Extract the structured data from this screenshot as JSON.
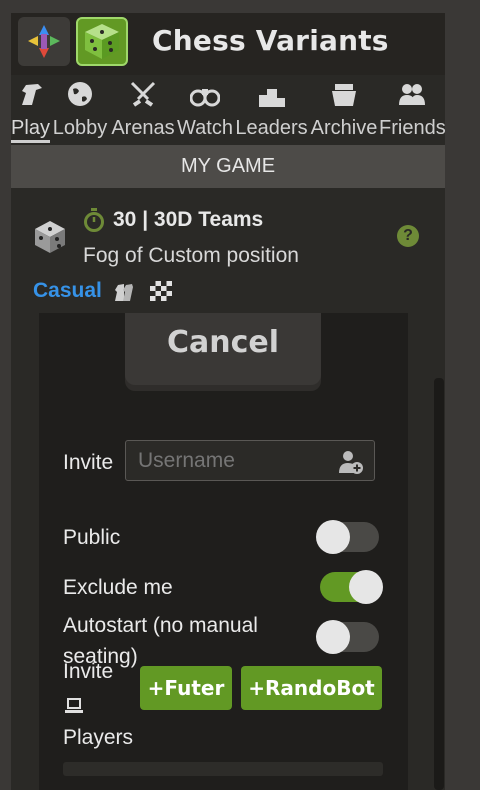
{
  "app": {
    "title": "Chess Variants"
  },
  "nav": {
    "items": [
      {
        "label": "Play",
        "icon": "knight-icon"
      },
      {
        "label": "Lobby",
        "icon": "globe-icon"
      },
      {
        "label": "Arenas",
        "icon": "crossed-swords-icon"
      },
      {
        "label": "Watch",
        "icon": "binoculars-icon"
      },
      {
        "label": "Leaders",
        "icon": "podium-icon"
      },
      {
        "label": "Archive",
        "icon": "archive-icon"
      },
      {
        "label": "Friends",
        "icon": "friends-icon"
      }
    ]
  },
  "section": {
    "title": "MY GAME"
  },
  "game": {
    "time_control": "30 | 30D Teams",
    "variant": "Fog of Custom position",
    "mode": "Casual",
    "help": "?"
  },
  "actions": {
    "cancel_label": "Cancel"
  },
  "form": {
    "invite_label": "Invite",
    "username_placeholder": "Username",
    "public_label": "Public",
    "public_on": false,
    "exclude_label": "Exclude me",
    "exclude_on": true,
    "autostart_label": "Autostart (no manual seating)",
    "autostart_on": false,
    "invite_bot_label": "Invite",
    "players_label": "Players",
    "bot_buttons": [
      "+Futer",
      "+RandoBot"
    ]
  },
  "colors": {
    "accent_green": "#629924",
    "link_blue": "#3692e7"
  }
}
